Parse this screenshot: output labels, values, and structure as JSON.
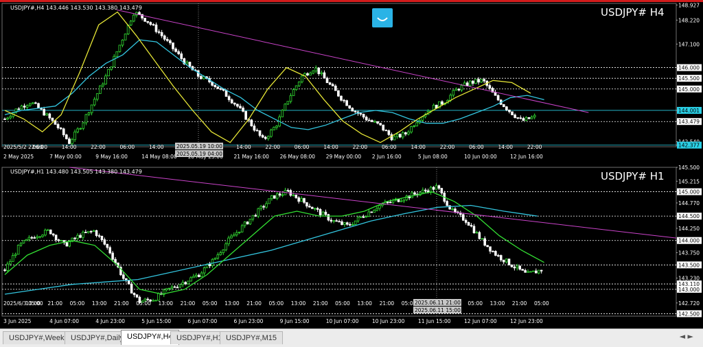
{
  "tabs": [
    {
      "label": "USDJPY#,Weekly",
      "active": false
    },
    {
      "label": "USDJPY#,Daily",
      "active": false
    },
    {
      "label": "USDJPY#,H4",
      "active": true
    },
    {
      "label": "USDJPY#,H1",
      "active": false
    },
    {
      "label": "USDJPY#,M15",
      "active": false
    }
  ],
  "tab_nav": "◄ ►",
  "colors": {
    "bull": "#33e033",
    "bear": "#ffffff",
    "ma_fast_h4": "#e6e636",
    "ma_slow": "#33c6e0",
    "ma_fast_h1": "#33e033",
    "trend": "#cc44cc",
    "level": "#ffffff",
    "highlight_label": "#2ad0e6"
  },
  "chart_data": [
    {
      "type": "candlestick",
      "symbol_info": "USDJPY#,H4  143.446 143.530 143.380 143.479",
      "watermark": "USDJPY#  H4",
      "ylim": [
        142.3,
        149.0
      ],
      "y_ticks": [
        "148.927",
        "148.220",
        "147.100",
        "146.000",
        "145.500",
        "145.000",
        "144.001",
        "143.479",
        "142.540",
        "142.377"
      ],
      "y_tick_values": [
        148.927,
        148.22,
        147.1,
        146.0,
        145.5,
        145.0,
        144.001,
        143.479,
        142.54,
        142.377
      ],
      "highlighted_ticks": [
        "144.001",
        "142.377"
      ],
      "current_price_label": "143.479",
      "horizontal_levels": [
        146.0,
        145.5,
        145.0,
        144.001,
        143.479,
        142.377
      ],
      "x_ticks": [
        "2025/5/2 22:00",
        "06:00",
        "14:00",
        "22:00",
        "06:00",
        "14:00",
        "22:00",
        "06:00",
        "14:00",
        "22:00",
        "06:00",
        "14:00",
        "22:00",
        "06:00",
        "14:00",
        "22:00",
        "06:00",
        "14:00",
        "22:00"
      ],
      "x_ticks_row2": [
        "2 May 2025",
        "7 May 00:00",
        "9 May 16:00",
        "14 May 08:00",
        "16 May 23:00",
        "21 May 16:00",
        "26 May 08:00",
        "29 May 00:00",
        "2 Jun 16:00",
        "5 Jun 08:00",
        "10 Jun 00:00",
        "12 Jun 16:00"
      ],
      "crosshair_time_top": "2025.05.19 10:00",
      "crosshair_time_bottom": "2025.05.19 04:00",
      "close_path": [
        143.6,
        144.1,
        144.4,
        143.9,
        143.3,
        142.5,
        143.4,
        144.6,
        145.8,
        147.2,
        148.6,
        148.2,
        147.6,
        146.9,
        146.2,
        145.6,
        145.3,
        144.8,
        144.2,
        143.4,
        142.6,
        143.3,
        144.6,
        145.6,
        146.0,
        145.3,
        144.6,
        144.0,
        143.6,
        143.3,
        142.7,
        142.9,
        143.6,
        144.1,
        144.4,
        145.0,
        145.3,
        145.4,
        144.6,
        144.0,
        143.5,
        143.7
      ],
      "ma_fast_path": [
        144.0,
        143.6,
        143.0,
        143.8,
        145.8,
        148.0,
        148.6,
        147.5,
        146.3,
        145.1,
        144.0,
        143.0,
        142.5,
        143.6,
        145.0,
        146.0,
        145.6,
        144.5,
        143.5,
        142.9,
        142.5,
        143.0,
        143.6,
        144.1,
        144.6,
        145.0,
        145.4,
        145.3,
        144.8
      ],
      "ma_slow_path": [
        143.8,
        144.0,
        144.1,
        144.2,
        144.8,
        145.6,
        146.2,
        146.6,
        147.3,
        147.2,
        146.6,
        146.0,
        145.5,
        145.0,
        144.6,
        144.0,
        143.6,
        143.2,
        143.1,
        143.3,
        143.6,
        143.9,
        144.0,
        143.9,
        143.6,
        143.4,
        143.4,
        143.6,
        143.9,
        144.2,
        144.6,
        144.7,
        144.5
      ],
      "trend_line": [
        [
          0.17,
          148.7
        ],
        [
          0.87,
          143.9
        ]
      ]
    },
    {
      "type": "candlestick",
      "symbol_info": "USDJPY#,H1  143.480 143.505 143.380 143.479",
      "watermark": "USDJPY#  H1",
      "ylim": [
        142.45,
        145.5
      ],
      "y_ticks": [
        "145.500",
        "145.215",
        "145.000",
        "144.770",
        "144.500",
        "144.250",
        "144.000",
        "143.750",
        "143.500",
        "143.230",
        "143.110",
        "143.000",
        "142.720",
        "142.500"
      ],
      "y_tick_values": [
        145.5,
        145.215,
        145.0,
        144.77,
        144.5,
        144.25,
        144.0,
        143.75,
        143.5,
        143.23,
        143.11,
        143.0,
        142.72,
        142.5
      ],
      "horizontal_levels": [
        145.0,
        144.5,
        144.0,
        143.5,
        143.11,
        143.0,
        142.5
      ],
      "x_ticks": [
        "2025/6/3 05:00",
        "13:00",
        "21:00",
        "05:00",
        "13:00",
        "21:00",
        "05:00",
        "13:00",
        "21:00",
        "05:00",
        "13:00",
        "21:00",
        "05:00",
        "13:00",
        "21:00",
        "05:00",
        "13:00",
        "21:00",
        "05:00",
        "13:00",
        "21:00",
        "05:00",
        "13:00",
        "21:00",
        "05:00"
      ],
      "x_ticks_row2": [
        "3 Jun 2025",
        "4 Jun 07:00",
        "4 Jun 23:00",
        "5 Jun 15:00",
        "6 Jun 07:00",
        "6 Jun 23:00",
        "9 Jun 15:00",
        "10 Jun 07:00",
        "10 Jun 23:00",
        "11 Jun 15:00",
        "12 Jun 07:00",
        "12 Jun 23:00"
      ],
      "crosshair_time_top": "2025.06.11 21:00",
      "crosshair_time_bottom": "2025.06.11 15:00",
      "close_path": [
        143.4,
        143.9,
        144.1,
        144.2,
        143.9,
        144.1,
        144.2,
        143.8,
        143.2,
        142.75,
        142.8,
        143.0,
        143.15,
        143.3,
        143.6,
        144.0,
        144.3,
        144.6,
        144.9,
        145.0,
        144.8,
        144.6,
        144.4,
        144.3,
        144.5,
        144.7,
        144.8,
        144.9,
        145.0,
        145.1,
        144.6,
        144.4,
        144.0,
        143.7,
        143.5,
        143.3,
        143.4
      ],
      "ma_fast_path": [
        143.3,
        143.7,
        143.9,
        144.0,
        143.9,
        143.5,
        143.0,
        142.9,
        143.0,
        143.3,
        143.7,
        144.1,
        144.5,
        144.6,
        144.5,
        144.5,
        144.6,
        144.8,
        144.9,
        145.0,
        144.8,
        144.5,
        144.1,
        143.8,
        143.55
      ],
      "ma_slow_path": [
        142.9,
        143.0,
        143.1,
        143.15,
        143.2,
        143.35,
        143.5,
        143.65,
        143.8,
        144.0,
        144.2,
        144.4,
        144.55,
        144.68,
        144.72,
        144.6,
        144.5
      ],
      "trend_line": [
        [
          0.1,
          145.5
        ],
        [
          1.0,
          144.05
        ]
      ]
    }
  ]
}
